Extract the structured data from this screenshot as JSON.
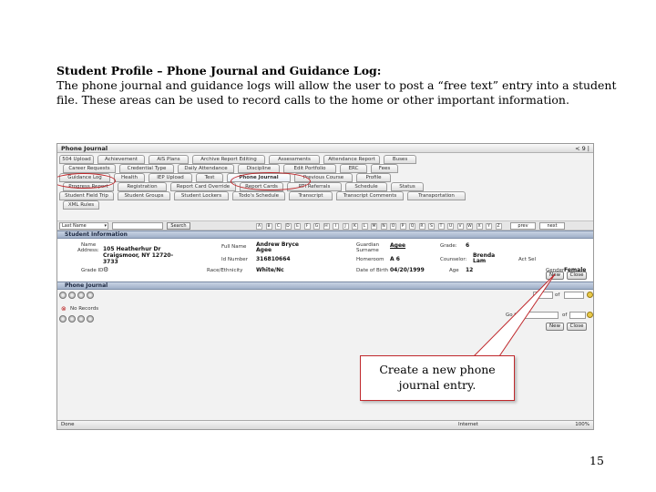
{
  "slide": {
    "title": "Student Profile – Phone Journal and Guidance Log:",
    "body": "The phone journal and guidance logs will allow the user to post a “free text” entry into a student file.   These areas can be used to record calls to the home or other important information.",
    "page_number": "15"
  },
  "callout": {
    "line1": "Create a new phone",
    "line2": "journal entry."
  },
  "screenshot": {
    "window_title": "Phone Journal",
    "window_right": "< 9 |",
    "tab_rows": [
      [
        "504 Upload",
        "Achievement",
        "AIS Plans",
        "Archive Report Editing",
        "Assessments",
        "Attendance Report",
        "Buses"
      ],
      [
        "Career Requests",
        "Credential Type",
        "Daily Attendance",
        "Discipline",
        "Edit Portfolio",
        "ERC",
        "Fees"
      ],
      [
        "Guidance Log",
        "Health",
        "IEP Upload",
        "Test",
        "Phone Journal",
        "Previous Course",
        "Profile"
      ],
      [
        "Progress Report",
        "Registration",
        "Report Card Override",
        "Report Cards",
        "RTI Referrals",
        "Schedule",
        "Status"
      ],
      [
        "Student Field Trip",
        "Student Groups",
        "Student Lockers",
        "Todo's Schedule",
        "Transcript",
        "Transcript Comments",
        "Transportation"
      ],
      [
        "XML Rules"
      ]
    ],
    "active_tab": "Phone Journal",
    "search": {
      "select_value": "Last Name",
      "button_label": "Search",
      "letters": [
        "A",
        "B",
        "C",
        "D",
        "E",
        "F",
        "G",
        "H",
        "I",
        "J",
        "K",
        "L",
        "M",
        "N",
        "O",
        "P",
        "Q",
        "R",
        "S",
        "T",
        "U",
        "V",
        "W",
        "X",
        "Y",
        "Z"
      ],
      "prev_label": "prev",
      "next_label": "next"
    },
    "student_info": {
      "header": "Student Information",
      "name_label": "Name",
      "address_label": "Address:",
      "address_value": "105 Heatherhur Dr",
      "address_city": "Craigsmoor, NY 12720-",
      "address_zip": "3733",
      "grade_code_label": "Grade ID",
      "full_name_label": "Full Name",
      "full_name_value": "Andrew Bryce",
      "full_name_value2": "Agee",
      "id_label": "Id Number",
      "id_value": "316810664",
      "race_label": "Race/Ethnicity",
      "race_value": "White/Nc",
      "surname_label": "Guardian Surname",
      "surname_value": "Agee",
      "homeroom_label": "Homeroom",
      "homeroom_value": "A 6",
      "dob_label": "Date of Birth",
      "dob_value": "04/20/1999",
      "grade_label": "Grade:",
      "grade_value": "6",
      "counselor_label": "Counselor:",
      "counselor_value": "Brenda",
      "counselor_value2": "Lam",
      "age_label": "Age",
      "age_value": "12",
      "gender_label": "Gender",
      "gender_value": "Female",
      "acs_label": "Act Sel"
    },
    "phone_journal": {
      "header": "Phone Journal",
      "no_records": "No Records",
      "new_label": "New",
      "close_label": "Close",
      "of_label": "of",
      "goto_label": "Go to"
    },
    "status_bar": {
      "left": "Done",
      "zone": "Internet",
      "zoom": "100%"
    }
  }
}
